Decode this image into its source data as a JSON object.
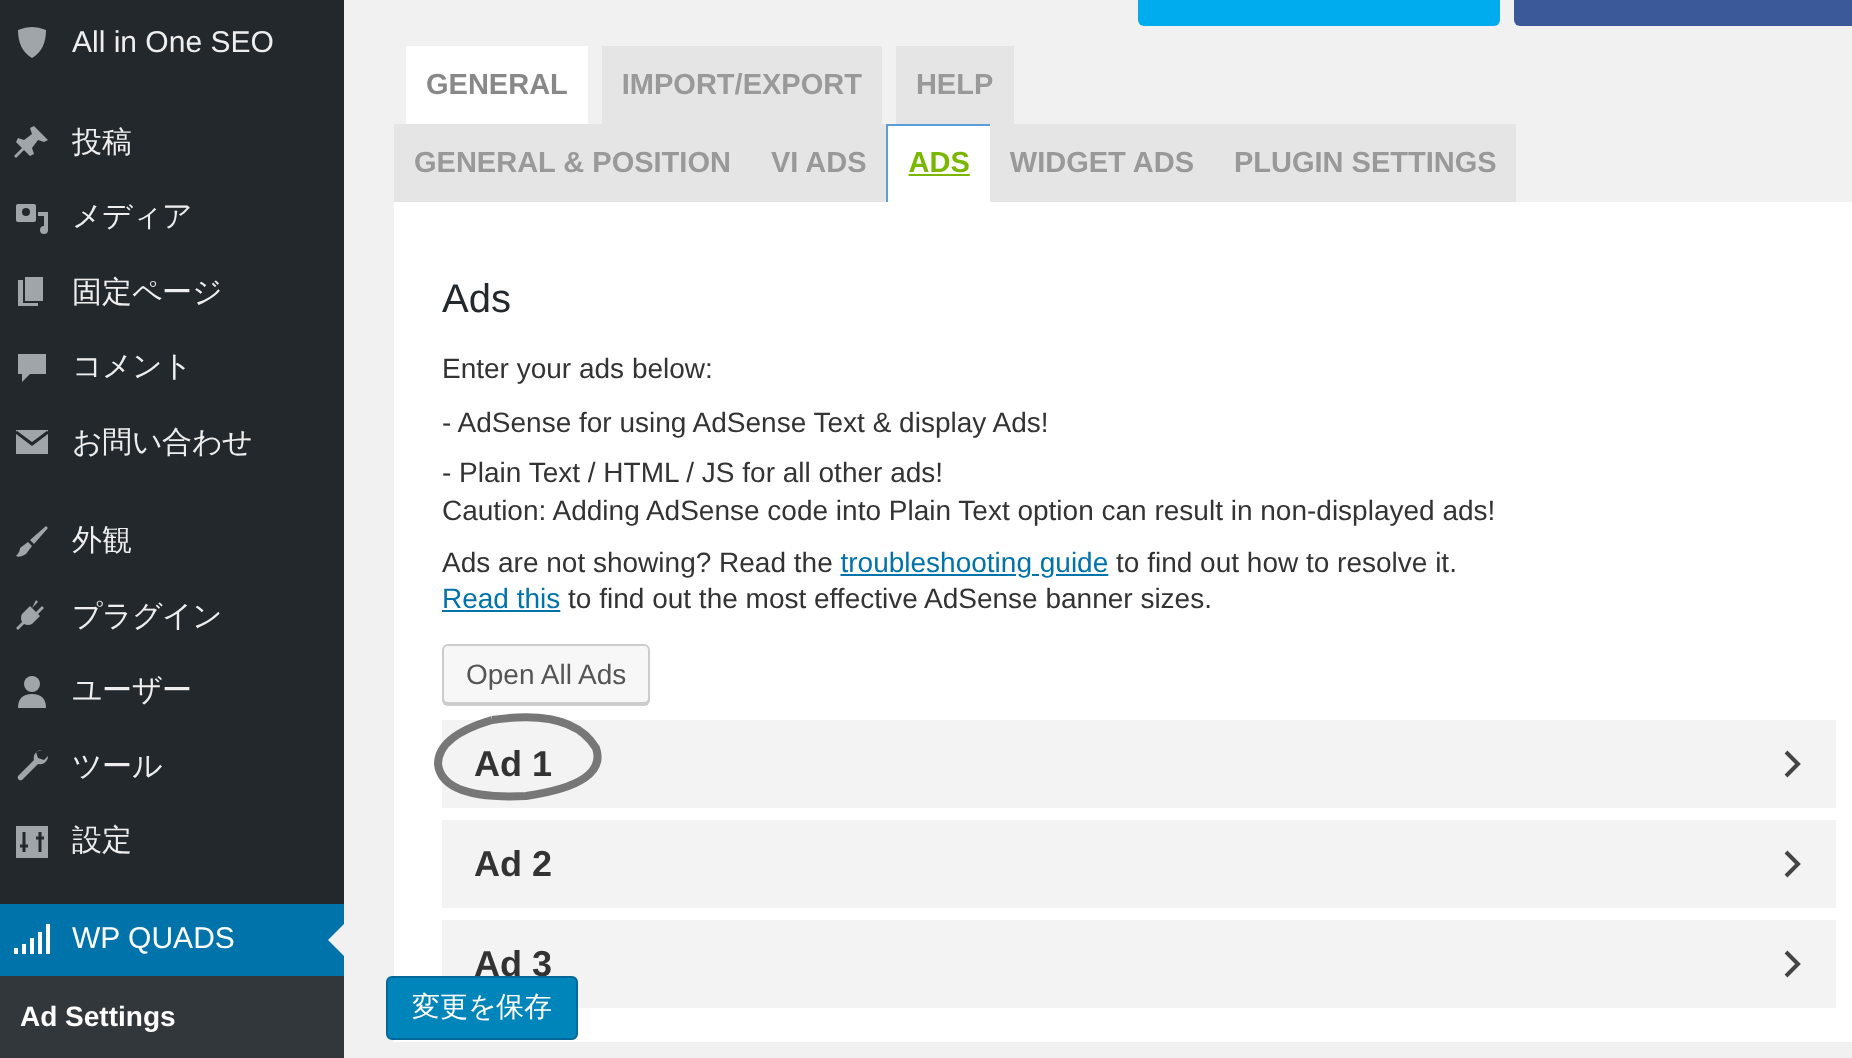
{
  "sidebar": {
    "groups": [
      [
        {
          "label": "All in One SEO",
          "selected": false
        }
      ],
      [
        {
          "label": "投稿",
          "selected": false
        },
        {
          "label": "メディア",
          "selected": false
        },
        {
          "label": "固定ページ",
          "selected": false
        },
        {
          "label": "コメント",
          "selected": false
        },
        {
          "label": "お問い合わせ",
          "selected": false
        }
      ],
      [
        {
          "label": "外観",
          "selected": false
        },
        {
          "label": "プラグイン",
          "selected": false
        },
        {
          "label": "ユーザー",
          "selected": false
        },
        {
          "label": "ツール",
          "selected": false
        },
        {
          "label": "設定",
          "selected": false
        }
      ],
      [
        {
          "label": "WP QUADS",
          "selected": true,
          "children": [
            {
              "label": "Ad Settings",
              "selected": true
            }
          ]
        }
      ]
    ]
  },
  "share_buttons": [
    {
      "kind": "tweet"
    },
    {
      "kind": "facebook"
    }
  ],
  "tabs": [
    {
      "label": "GENERAL",
      "selected": true
    },
    {
      "label": "IMPORT/EXPORT",
      "selected": false
    },
    {
      "label": "HELP",
      "selected": false
    }
  ],
  "subtabs": [
    {
      "label": "GENERAL & POSITION",
      "selected": false
    },
    {
      "label": "VI ADS",
      "selected": false
    },
    {
      "label": "ADS",
      "selected": true
    },
    {
      "label": "WIDGET ADS",
      "selected": false
    },
    {
      "label": "PLUGIN SETTINGS",
      "selected": false
    }
  ],
  "panel": {
    "heading": "Ads",
    "intro": "Enter your ads below:",
    "notes": [
      "- AdSense for using AdSense Text & display Ads!",
      "- Plain Text / HTML / JS for all other ads!",
      "Caution: Adding AdSense code into Plain Text option can result in non-displayed ads!"
    ],
    "help_lines": [
      [
        {
          "text": "Ads are not showing? Read the "
        },
        {
          "text": "troubleshooting guide",
          "kind": "link"
        },
        {
          "text": " to find out how to resolve it."
        }
      ],
      [
        {
          "text": "Read this",
          "kind": "link"
        },
        {
          "text": " to find out the most effective AdSense banner sizes."
        }
      ]
    ],
    "open_all_button": "Open All Ads",
    "ads": [
      {
        "title": "Ad 1",
        "circled": true
      },
      {
        "title": "Ad 2",
        "circled": false
      },
      {
        "title": "Ad 3",
        "circled": false
      }
    ],
    "save_button": "変更を保存"
  }
}
